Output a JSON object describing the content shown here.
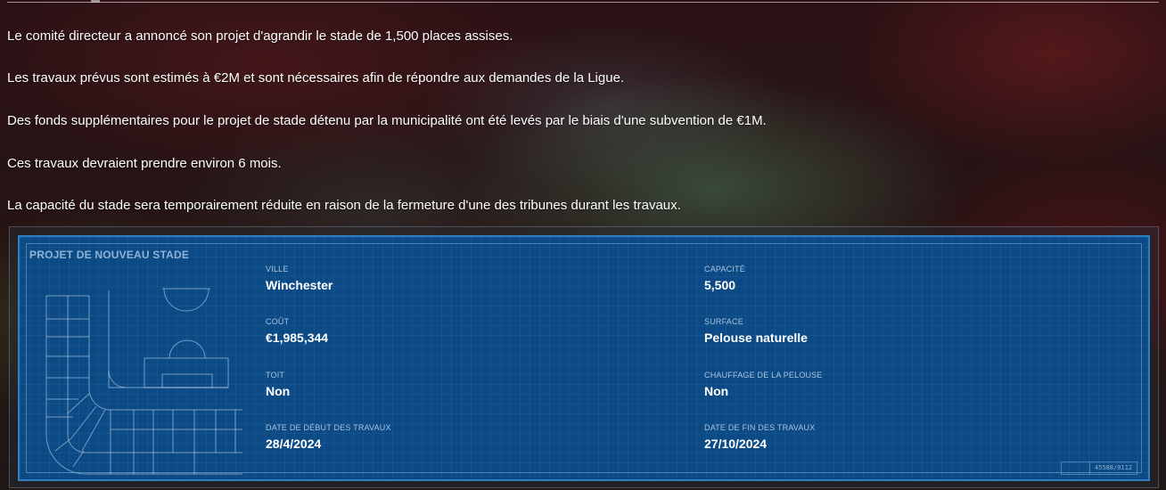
{
  "news": {
    "paragraphs": [
      "Le comité directeur a annoncé son projet d'agrandir le stade de 1,500 places assises.",
      "Les travaux prévus sont estimés à €2M et sont nécessaires afin de répondre aux demandes de la Ligue.",
      "Des fonds supplémentaires pour le projet de stade détenu par la municipalité ont été levés par le biais d'une subvention de €1M.",
      "Ces travaux devraient prendre environ 6 mois.",
      "La capacité du stade sera temporairement réduite en raison de la fermeture d'une des tribunes durant les travaux."
    ]
  },
  "stadium_project": {
    "title": "PROJET DE NOUVEAU STADE",
    "fields": {
      "city": {
        "label": "VILLE",
        "value": "Winchester"
      },
      "capacity": {
        "label": "CAPACITÉ",
        "value": "5,500"
      },
      "cost": {
        "label": "COÛT",
        "value": "€1,985,344"
      },
      "surface": {
        "label": "SURFACE",
        "value": "Pelouse naturelle"
      },
      "roof": {
        "label": "TOIT",
        "value": "Non"
      },
      "pitch_heating": {
        "label": "CHAUFFAGE DE LA PELOUSE",
        "value": "Non"
      },
      "start_date": {
        "label": "DATE DE DÉBUT DES TRAVAUX",
        "value": "28/4/2024"
      },
      "end_date": {
        "label": "DATE DE FIN DES TRAVAUX",
        "value": "27/10/2024"
      }
    },
    "stamp_code": "45588/0112"
  },
  "colors": {
    "panel_background": "#0c4a86",
    "panel_border": "#2c7fc0",
    "title_color": "#8fb3d6",
    "label_color": "#a9c4de"
  }
}
